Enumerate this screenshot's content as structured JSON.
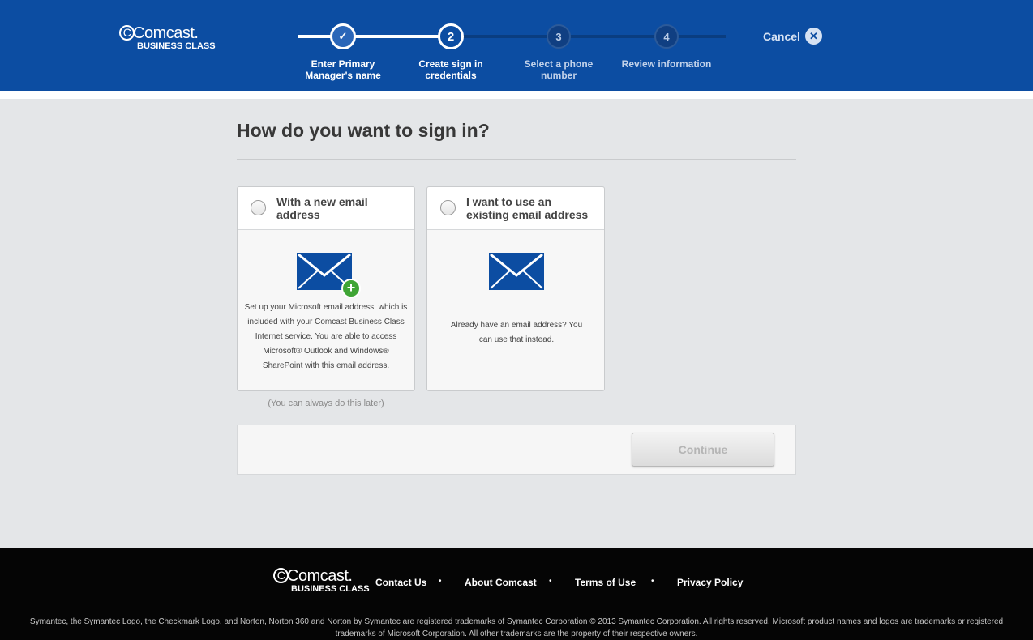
{
  "brand": {
    "name": "Comcast.",
    "sub": "BUSINESS CLASS"
  },
  "wizard": {
    "steps": [
      {
        "number": "✓",
        "label": "Enter Primary Manager's name"
      },
      {
        "number": "2",
        "label": "Create sign in credentials"
      },
      {
        "number": "3",
        "label": "Select a phone number"
      },
      {
        "number": "4",
        "label": "Review information"
      }
    ],
    "cancel_label": "Cancel"
  },
  "main": {
    "title": "How do you want to sign in?",
    "options": [
      {
        "title": "With a new email address",
        "description": "Set up your Microsoft email address, which is included with your Comcast Business Class Internet service. You are able to access Microsoft® Outlook and Windows® SharePoint with this email address.",
        "icon": "envelope-plus-icon"
      },
      {
        "title": "I want to use an existing email address",
        "description": "Already have an email address? You can use that instead.",
        "icon": "envelope-icon"
      }
    ],
    "later_note": "(You can always do this later)",
    "continue_label": "Continue"
  },
  "footer": {
    "links": [
      "Contact Us",
      "About Comcast",
      "Terms of Use",
      "Privacy Policy"
    ],
    "legal": "Symantec, the Symantec Logo, the Checkmark Logo, and Norton, Norton 360 and Norton by Symantec are registered trademarks of Symantec Corporation © 2013 Symantec Corporation. All rights reserved. Microsoft product names and logos are trademarks or registered trademarks of Microsoft Corporation. All other trademarks are the property of their respective owners."
  },
  "colors": {
    "header_bg": "#0c4da2",
    "footer_bg": "#050505",
    "accent_green": "#3fa535"
  }
}
